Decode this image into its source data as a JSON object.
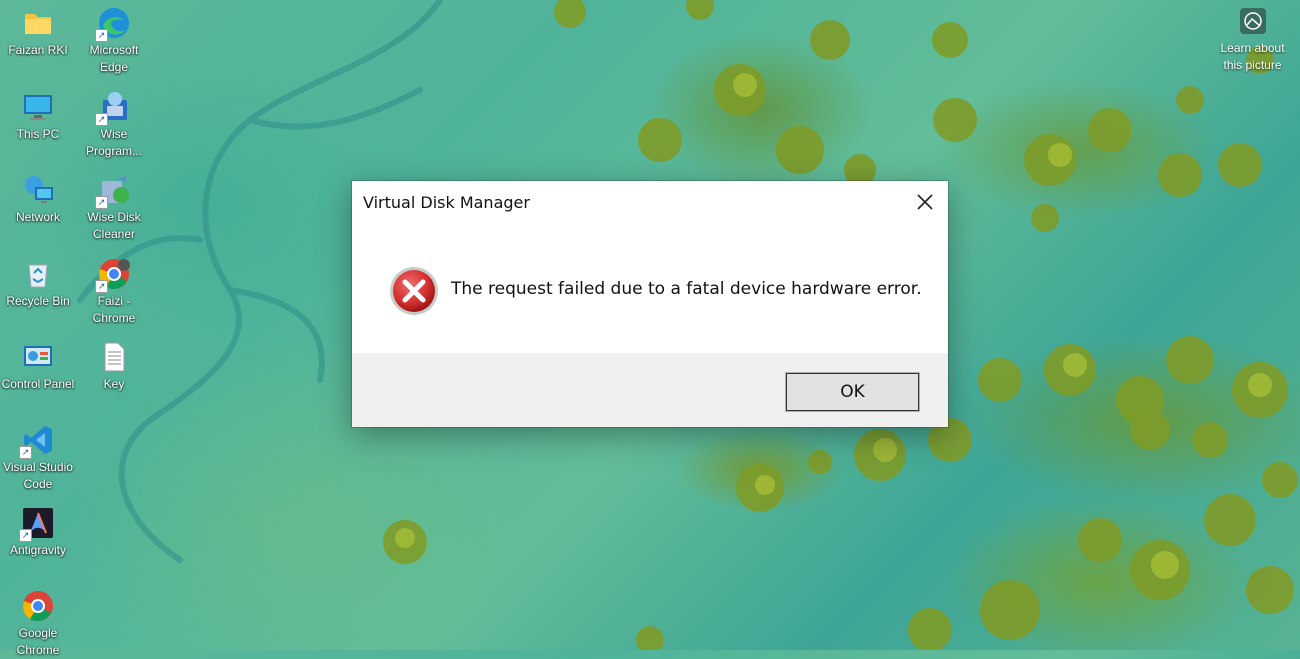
{
  "desktop": {
    "icons": [
      {
        "label": "Faizan RKI",
        "icon": "folder-icon"
      },
      {
        "label": "Microsoft\nEdge",
        "icon": "edge-icon"
      },
      {
        "label": "This PC",
        "icon": "monitor-icon"
      },
      {
        "label": "Wise\nProgram...",
        "icon": "wise-program-icon"
      },
      {
        "label": "Network",
        "icon": "network-icon"
      },
      {
        "label": "Wise Disk\nCleaner",
        "icon": "wise-disk-cleaner-icon"
      },
      {
        "label": "Recycle Bin",
        "icon": "recycle-bin-icon"
      },
      {
        "label": "Faizi -\nChrome",
        "icon": "chrome-icon"
      },
      {
        "label": "Control Panel",
        "icon": "control-panel-icon"
      },
      {
        "label": "Key",
        "icon": "text-file-icon"
      },
      {
        "label": "Visual Studio\nCode",
        "icon": "vscode-icon"
      },
      {
        "label": "Antigravity",
        "icon": "antigravity-icon"
      },
      {
        "label": "Google\nChrome",
        "icon": "chrome-icon"
      }
    ],
    "learn_picture": {
      "label": "Learn about\nthis picture",
      "icon": "camera-icon"
    }
  },
  "dialog": {
    "title": "Virtual Disk Manager",
    "message": "The request failed due to a fatal device hardware error.",
    "icon": "error-icon",
    "ok_label": "OK",
    "colors": {
      "error_red": "#d12d2d",
      "footer_bg": "#f0f0f0"
    }
  }
}
